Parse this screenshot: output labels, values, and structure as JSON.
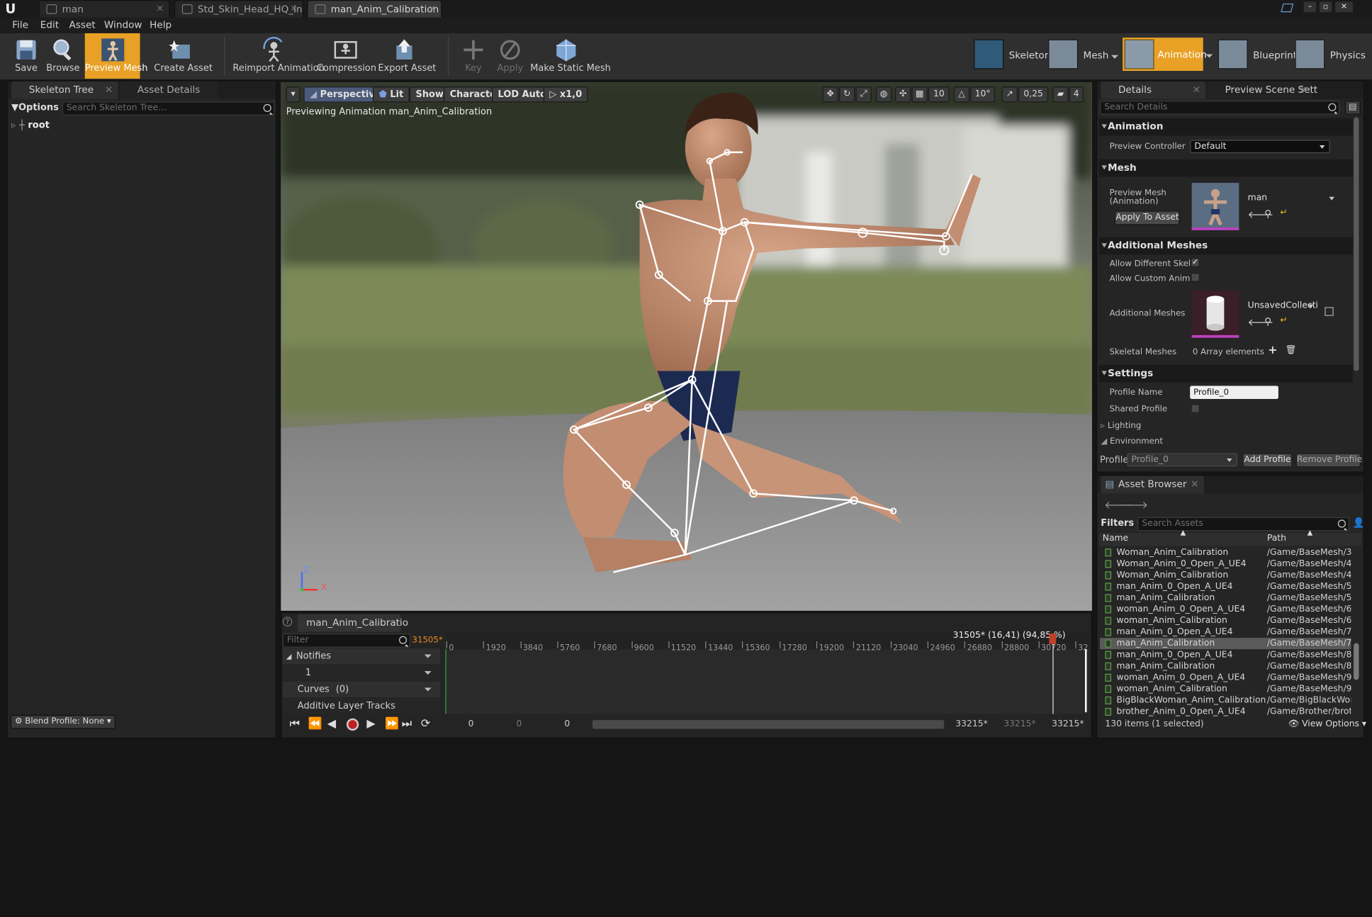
{
  "window": {
    "tabs": [
      {
        "label": "man"
      },
      {
        "label": "Std_Skin_Head_HQ_Inst*"
      },
      {
        "label": "man_Anim_Calibration"
      }
    ]
  },
  "menu": [
    "File",
    "Edit",
    "Asset",
    "Window",
    "Help"
  ],
  "toolbar": {
    "save": "Save",
    "browse": "Browse",
    "preview_mesh": "Preview Mesh",
    "create_asset": "Create Asset",
    "reimport": "Reimport Animation",
    "compression": "Compression",
    "export": "Export Asset",
    "key": "Key",
    "apply": "Apply",
    "make_static": "Make Static Mesh"
  },
  "modes": {
    "skeleton": "Skeleton",
    "mesh": "Mesh",
    "animation": "Animation",
    "blueprint": "Blueprint",
    "physics": "Physics"
  },
  "left_panel": {
    "tab1": "Skeleton Tree",
    "tab2": "Asset Details",
    "options": "Options",
    "search_placeholder": "Search Skeleton Tree...",
    "root": "root",
    "blend_profile": "Blend Profile: None"
  },
  "viewport": {
    "perspective": "Perspective",
    "lit": "Lit",
    "show": "Show",
    "character": "Character",
    "lod": "LOD Auto",
    "speed": "x1,0",
    "grid": "10",
    "angle": "10°",
    "scale": "0,25",
    "cam_speed": "4",
    "preview_text": "Previewing Animation man_Anim_Calibration",
    "axis_z": "Z",
    "axis_x": "X"
  },
  "details": {
    "tab1": "Details",
    "tab2": "Preview Scene Sett",
    "search_placeholder": "Search Details",
    "sec_animation": "Animation",
    "preview_controller_label": "Preview Controller",
    "preview_controller_value": "Default",
    "sec_mesh": "Mesh",
    "preview_mesh_label": "Preview Mesh (Animation)",
    "preview_mesh_value": "man",
    "apply_to_asset": "Apply To Asset",
    "sec_additional": "Additional Meshes",
    "allow_diff": "Allow Different Skelet",
    "allow_custom": "Allow Custom AnimBl",
    "additional_meshes_label": "Additional Meshes",
    "additional_meshes_value": "UnsavedCollection",
    "skeletal_meshes_label": "Skeletal Meshes",
    "skeletal_meshes_value": "0 Array elements",
    "sec_settings": "Settings",
    "profile_name_label": "Profile Name",
    "profile_name_value": "Profile_0",
    "shared_profile_label": "Shared Profile",
    "lighting": "Lighting",
    "environment": "Environment",
    "profile_label": "Profile",
    "profile_value": "Profile_0",
    "add_profile": "Add Profile",
    "remove_profile": "Remove Profile"
  },
  "asset_browser": {
    "tab": "Asset Browser",
    "filters": "Filters",
    "search_placeholder": "Search Assets",
    "col_name": "Name",
    "col_path": "Path",
    "rows": [
      {
        "name": "Woman_Anim_Calibration",
        "path": "/Game/BaseMesh/3/"
      },
      {
        "name": "Woman_Anim_0_Open_A_UE4",
        "path": "/Game/BaseMesh/4/"
      },
      {
        "name": "Woman_Anim_Calibration",
        "path": "/Game/BaseMesh/4/"
      },
      {
        "name": "man_Anim_0_Open_A_UE4",
        "path": "/Game/BaseMesh/5/"
      },
      {
        "name": "man_Anim_Calibration",
        "path": "/Game/BaseMesh/5/"
      },
      {
        "name": "woman_Anim_0_Open_A_UE4",
        "path": "/Game/BaseMesh/6/"
      },
      {
        "name": "woman_Anim_Calibration",
        "path": "/Game/BaseMesh/6/"
      },
      {
        "name": "man_Anim_0_Open_A_UE4",
        "path": "/Game/BaseMesh/7/"
      },
      {
        "name": "man_Anim_Calibration",
        "path": "/Game/BaseMesh/7/"
      },
      {
        "name": "man_Anim_0_Open_A_UE4",
        "path": "/Game/BaseMesh/8/"
      },
      {
        "name": "man_Anim_Calibration",
        "path": "/Game/BaseMesh/8/"
      },
      {
        "name": "woman_Anim_0_Open_A_UE4",
        "path": "/Game/BaseMesh/9/"
      },
      {
        "name": "woman_Anim_Calibration",
        "path": "/Game/BaseMesh/9/"
      },
      {
        "name": "BigBlackWoman_Anim_Calibration",
        "path": "/Game/BigBlackWom"
      },
      {
        "name": "brother_Anim_0_Open_A_UE4",
        "path": "/Game/Brother/broth"
      }
    ],
    "selected_index": 8,
    "item_count": "130 items (1 selected)",
    "view_options": "View Options"
  },
  "timeline": {
    "tab": "man_Anim_Calibratio",
    "filter_placeholder": "Filter",
    "current_frame_left": "31505*",
    "notifies": "Notifies",
    "notify_track": "1",
    "curves": "Curves",
    "curves_count": "(0)",
    "additive": "Additive Layer Tracks",
    "frame_readout": "31505* (16,41) (94,85 %)",
    "ticks": [
      "0",
      "1920",
      "3840",
      "5760",
      "7680",
      "9600",
      "11520",
      "13440",
      "15360",
      "17280",
      "19200",
      "21120",
      "23040",
      "24960",
      "26880",
      "28800",
      "30720",
      "32"
    ],
    "start_frame": "0",
    "range_a": "0",
    "range_b": "0",
    "end_a": "33215*",
    "end_b": "33215*",
    "end_c": "33215*",
    "playhead_percent": 94.85
  }
}
